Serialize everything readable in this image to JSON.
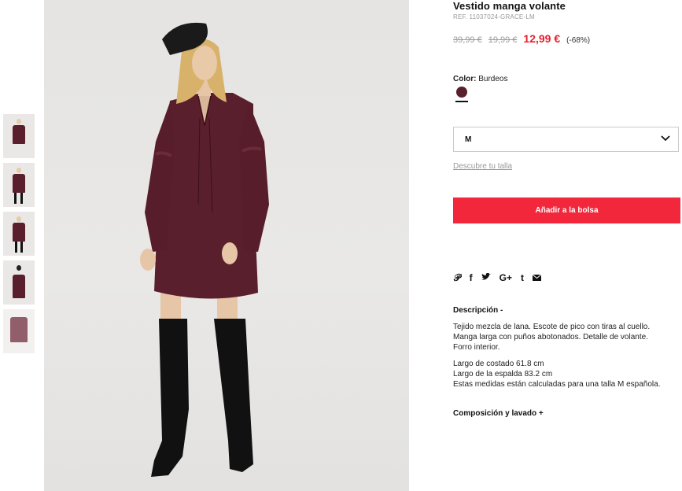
{
  "product": {
    "title": "Vestido manga volante",
    "ref": "REF. 11037024-GRACE-LM",
    "prices": {
      "original": "39,99 €",
      "previous": "19,99 €",
      "current": "12,99 €",
      "discount": "(-68%)"
    },
    "color": {
      "label": "Color:",
      "value": "Burdeos",
      "swatch_hex": "#5a1f2c"
    },
    "size": {
      "selected": "M",
      "guide_link": "Descubre tu talla"
    },
    "add_to_bag": "Añadir a la bolsa",
    "share_icons": [
      "pinterest-icon",
      "facebook-icon",
      "twitter-icon",
      "google-plus-icon",
      "tumblr-icon",
      "email-icon"
    ],
    "description": {
      "title": "Descripción -",
      "paragraph1": [
        "Tejido mezcla de lana. Escote de pico con tiras al cuello.",
        "Manga larga con puños abotonados. Detalle de volante.",
        "Forro interior."
      ],
      "paragraph2": [
        "Largo de costado 61.8 cm",
        "Largo de la espalda 83.2 cm",
        "Estas medidas están calculadas para una talla M española."
      ]
    },
    "composition_title": "Composición y lavado +"
  },
  "colors": {
    "accent": "#f2273b",
    "sale_price": "#e4202f",
    "dress": "#5a1f2c"
  }
}
